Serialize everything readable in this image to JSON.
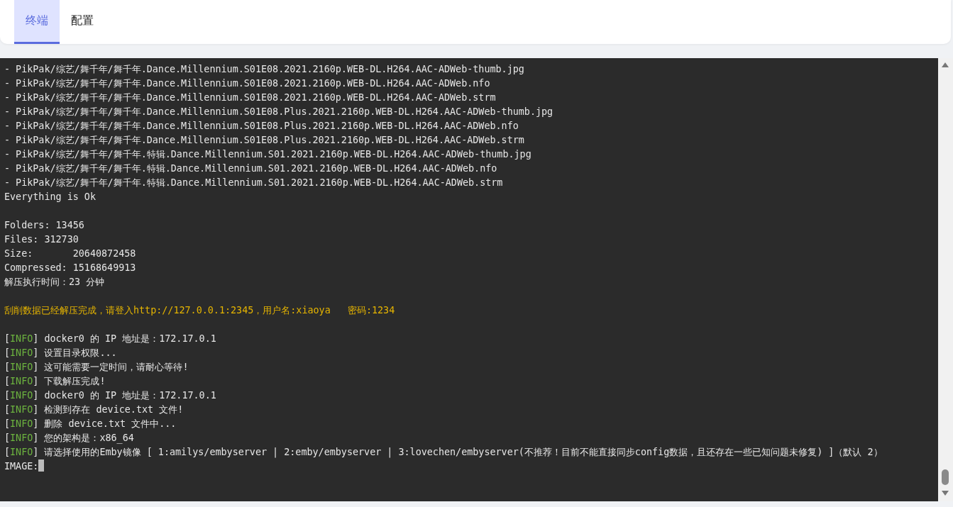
{
  "tabs": [
    {
      "label": "终端",
      "selected": true
    },
    {
      "label": "配置",
      "selected": false
    }
  ],
  "terminal": {
    "lines": [
      {
        "kind": "plain",
        "text": "- PikPak/综艺/舞千年/舞千年.Dance.Millennium.S01E08.2021.2160p.WEB-DL.H264.AAC-ADWeb-thumb.jpg"
      },
      {
        "kind": "plain",
        "text": "- PikPak/综艺/舞千年/舞千年.Dance.Millennium.S01E08.2021.2160p.WEB-DL.H264.AAC-ADWeb.nfo"
      },
      {
        "kind": "plain",
        "text": "- PikPak/综艺/舞千年/舞千年.Dance.Millennium.S01E08.2021.2160p.WEB-DL.H264.AAC-ADWeb.strm"
      },
      {
        "kind": "plain",
        "text": "- PikPak/综艺/舞千年/舞千年.Dance.Millennium.S01E08.Plus.2021.2160p.WEB-DL.H264.AAC-ADWeb-thumb.jpg"
      },
      {
        "kind": "plain",
        "text": "- PikPak/综艺/舞千年/舞千年.Dance.Millennium.S01E08.Plus.2021.2160p.WEB-DL.H264.AAC-ADWeb.nfo"
      },
      {
        "kind": "plain",
        "text": "- PikPak/综艺/舞千年/舞千年.Dance.Millennium.S01E08.Plus.2021.2160p.WEB-DL.H264.AAC-ADWeb.strm"
      },
      {
        "kind": "plain",
        "text": "- PikPak/综艺/舞千年/舞千年.特辑.Dance.Millennium.S01.2021.2160p.WEB-DL.H264.AAC-ADWeb-thumb.jpg"
      },
      {
        "kind": "plain",
        "text": "- PikPak/综艺/舞千年/舞千年.特辑.Dance.Millennium.S01.2021.2160p.WEB-DL.H264.AAC-ADWeb.nfo"
      },
      {
        "kind": "plain",
        "text": "- PikPak/综艺/舞千年/舞千年.特辑.Dance.Millennium.S01.2021.2160p.WEB-DL.H264.AAC-ADWeb.strm"
      },
      {
        "kind": "plain",
        "text": "Everything is Ok"
      },
      {
        "kind": "blank"
      },
      {
        "kind": "plain",
        "text": "Folders: 13456"
      },
      {
        "kind": "plain",
        "text": "Files: 312730"
      },
      {
        "kind": "plain",
        "text": "Size:       20640872458"
      },
      {
        "kind": "plain",
        "text": "Compressed: 15168649913"
      },
      {
        "kind": "plain",
        "text": "解压执行时间：23 分钟"
      },
      {
        "kind": "blank"
      },
      {
        "kind": "warning",
        "text": "刮削数据已经解压完成，请登入http://127.0.0.1:2345，用户名:xiaoya   密码:1234"
      },
      {
        "kind": "blank"
      },
      {
        "kind": "info",
        "tag": [
          "[",
          "INFO",
          "]"
        ],
        "text": " docker0 的 IP 地址是：172.17.0.1"
      },
      {
        "kind": "info",
        "tag": [
          "[",
          "INFO",
          "]"
        ],
        "text": " 设置目录权限..."
      },
      {
        "kind": "info",
        "tag": [
          "[",
          "INFO",
          "]"
        ],
        "text": " 这可能需要一定时间，请耐心等待!"
      },
      {
        "kind": "info",
        "tag": [
          "[",
          "INFO",
          "]"
        ],
        "text": " 下载解压完成!"
      },
      {
        "kind": "info",
        "tag": [
          "[",
          "INFO",
          "]"
        ],
        "text": " docker0 的 IP 地址是：172.17.0.1"
      },
      {
        "kind": "info",
        "tag": [
          "[",
          "INFO",
          "]"
        ],
        "text": " 检测到存在 device.txt 文件!"
      },
      {
        "kind": "info",
        "tag": [
          "[",
          "INFO",
          "]"
        ],
        "text": " 删除 device.txt 文件中..."
      },
      {
        "kind": "info",
        "tag": [
          "[",
          "INFO",
          "]"
        ],
        "text": " 您的架构是：x86_64"
      },
      {
        "kind": "info",
        "tag": [
          "[",
          "INFO",
          "]"
        ],
        "text": " 请选择使用的Emby镜像 [ 1:amilys/embyserver | 2:emby/embyserver | 3:lovechen/embyserver(不推荐！目前不能直接同步config数据，且还存在一些已知问题未修复) ]（默认 2）"
      },
      {
        "kind": "prompt",
        "text": "IMAGE:"
      }
    ]
  }
}
